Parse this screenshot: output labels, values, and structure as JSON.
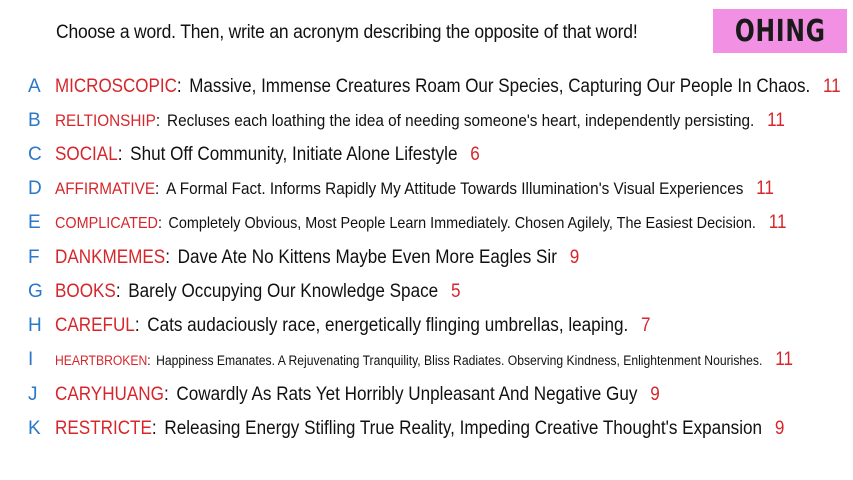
{
  "prompt": "Choose a word. Then, write an acronym describing the opposite of that word!",
  "badge": "OHING",
  "colors": {
    "letter": "#2a78c8",
    "word": "#d6262b",
    "count": "#d6262b",
    "badge_bg": "#f290e4",
    "text": "#111111"
  },
  "rows": [
    {
      "letter": "A",
      "word": "MICROSCOPIC",
      "acronym": "Massive, Immense Creatures Roam Our Species, Capturing Our People In Chaos.",
      "count": "11"
    },
    {
      "letter": "B",
      "word": "RELTIONSHIP",
      "acronym": "Recluses each loathing the idea of needing someone's heart, independently persisting.",
      "count": "11"
    },
    {
      "letter": "C",
      "word": "SOCIAL",
      "acronym": "Shut Off Community, Initiate Alone Lifestyle",
      "count": "6"
    },
    {
      "letter": "D",
      "word": "AFFIRMATIVE",
      "acronym": "A Formal Fact. Informs Rapidly My Attitude Towards Illumination's Visual Experiences",
      "count": "11"
    },
    {
      "letter": "E",
      "word": "COMPLICATED",
      "acronym": "Completely Obvious, Most People Learn Immediately. Chosen Agilely, The Easiest Decision.",
      "count": "11"
    },
    {
      "letter": "F",
      "word": "DANKMEMES",
      "acronym": "Dave Ate No Kittens Maybe Even More Eagles Sir",
      "count": "9"
    },
    {
      "letter": "G",
      "word": "BOOKS",
      "acronym": "Barely Occupying Our Knowledge Space",
      "count": "5"
    },
    {
      "letter": "H",
      "word": "CAREFUL",
      "acronym": "Cats audaciously race, energetically flinging umbrellas, leaping.",
      "count": "7"
    },
    {
      "letter": "I",
      "word": "HEARTBROKEN",
      "acronym": "Happiness Emanates. A Rejuvenating Tranquility, Bliss Radiates. Observing Kindness, Enlightenment Nourishes.",
      "count": "11"
    },
    {
      "letter": "J",
      "word": "CARYHUANG",
      "acronym": "Cowardly As Rats Yet Horribly Unpleasant And Negative Guy",
      "count": "9"
    },
    {
      "letter": "K",
      "word": "RESTRICTE",
      "acronym": "Releasing Energy Stifling True Reality, Impeding Creative Thought's Expansion",
      "count": "9"
    }
  ]
}
